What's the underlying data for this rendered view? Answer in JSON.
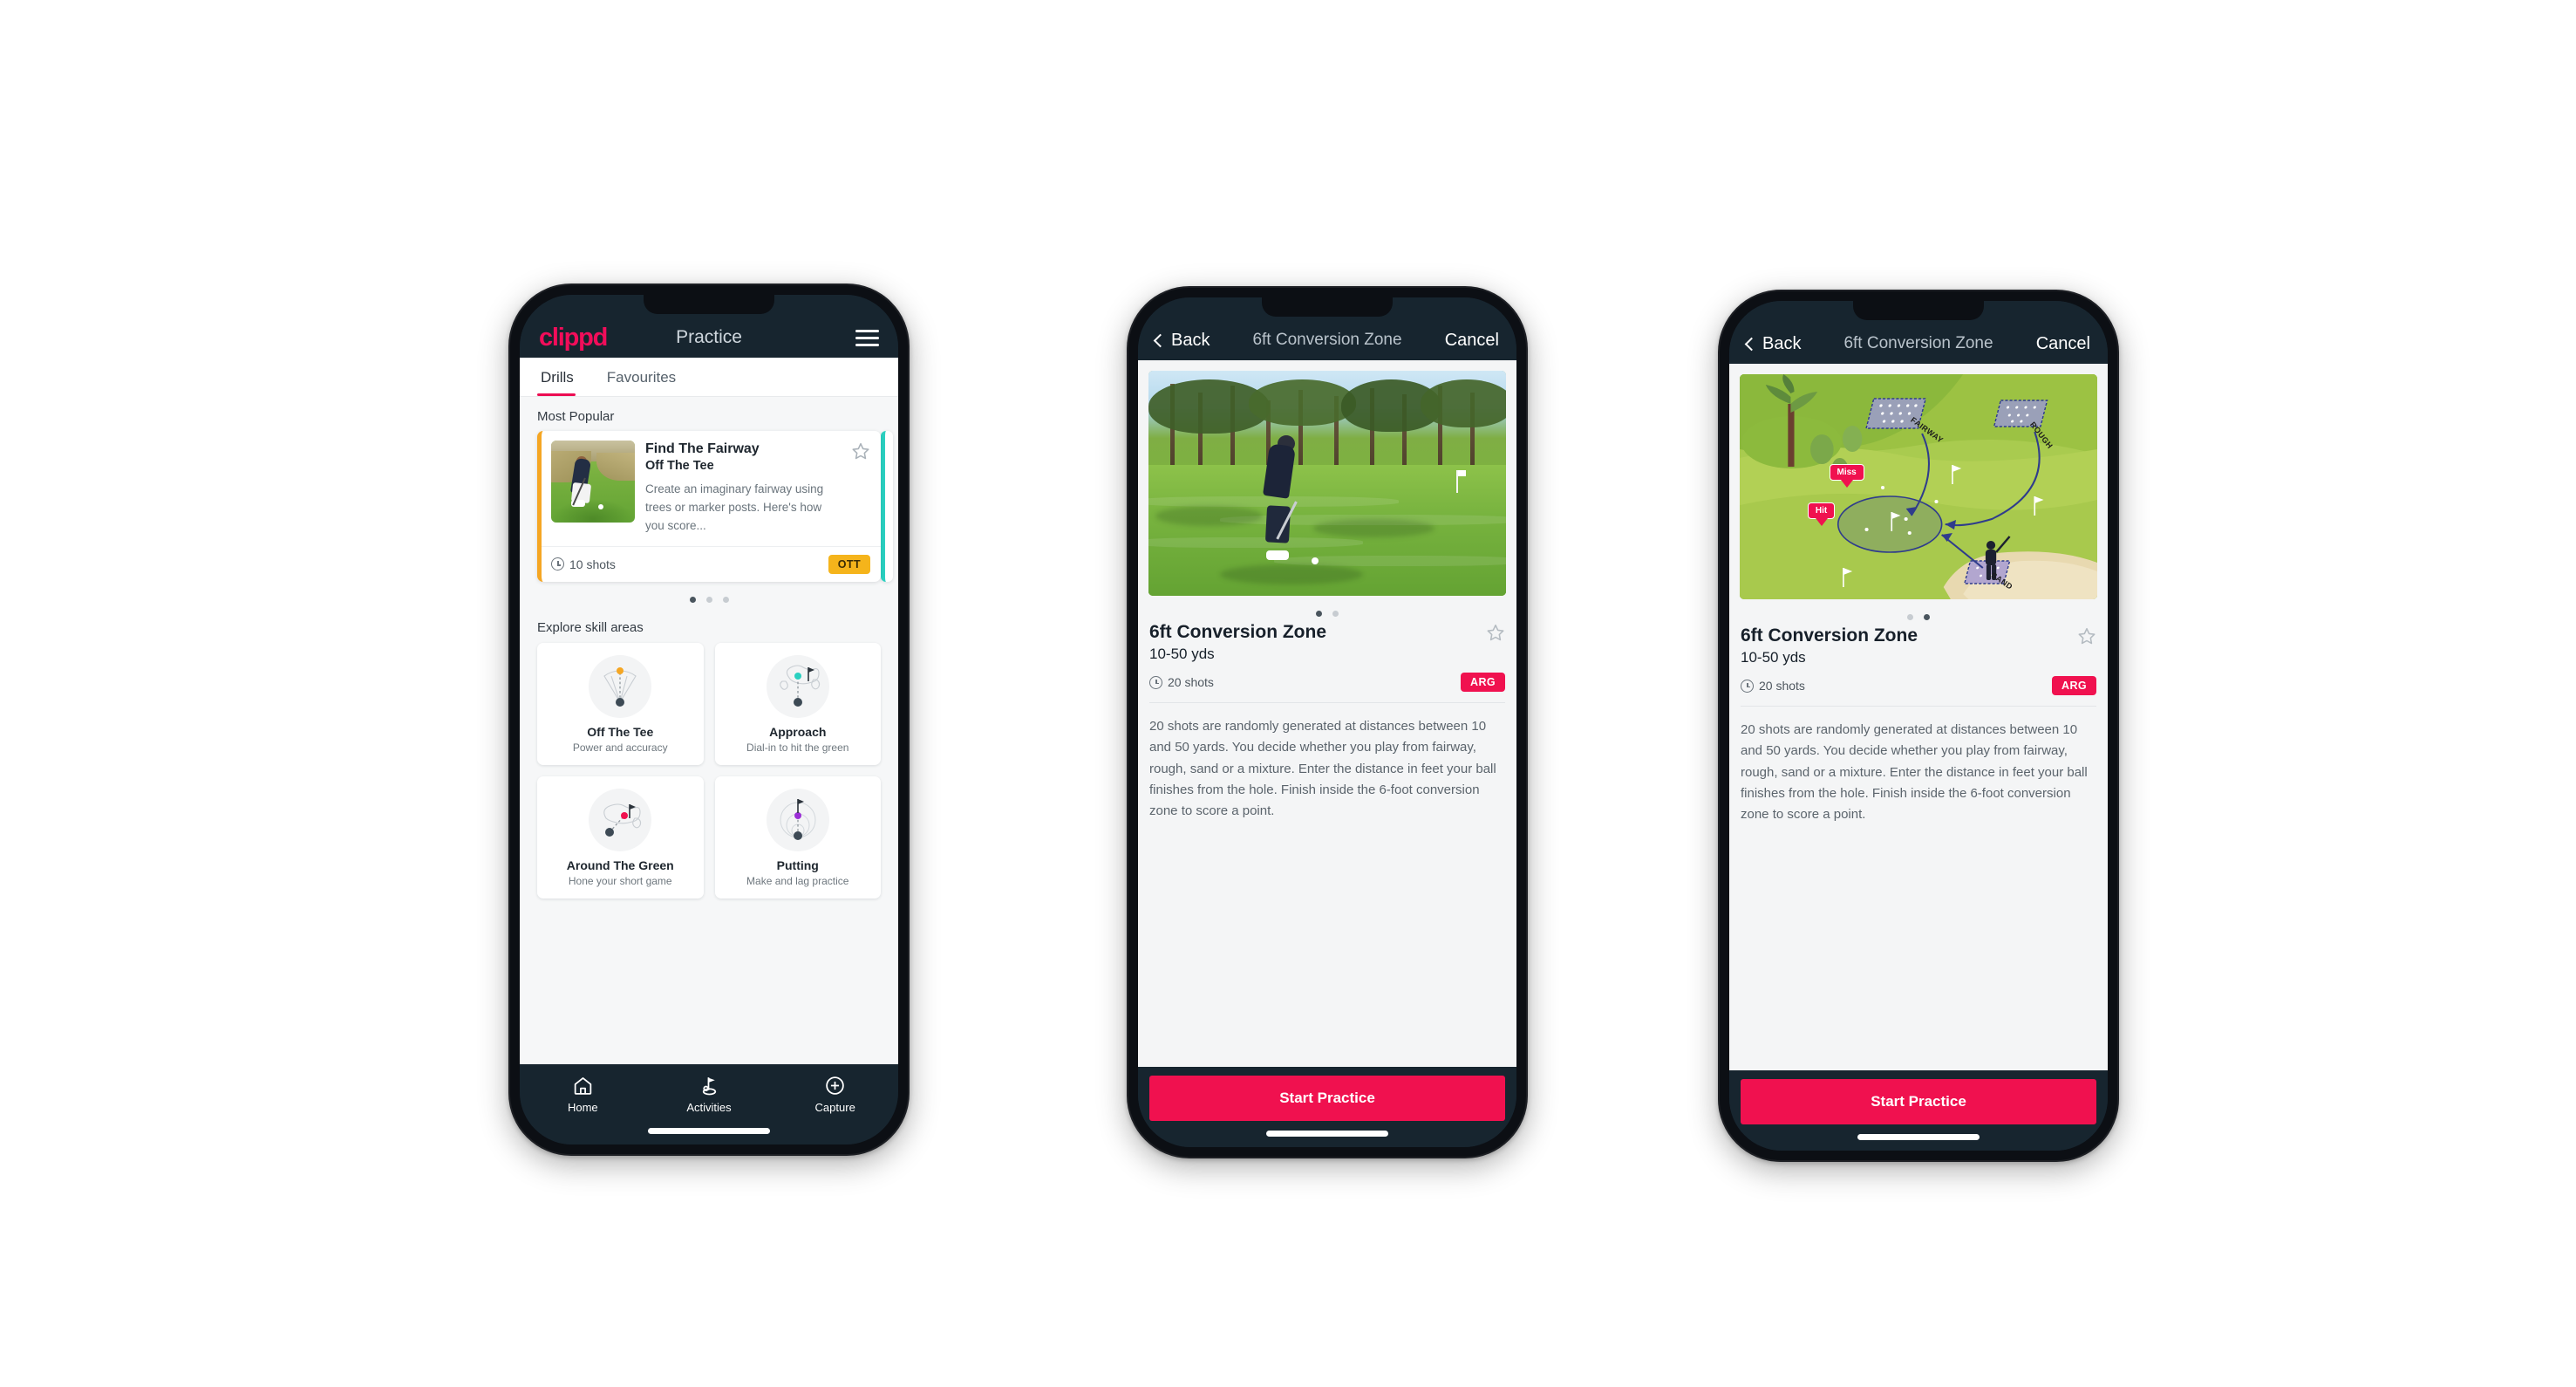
{
  "phone1": {
    "appbar": {
      "logo": "clippd",
      "title": "Practice",
      "menu_icon": "hamburger-icon"
    },
    "tabs": [
      {
        "label": "Drills",
        "active": true
      },
      {
        "label": "Favourites",
        "active": false
      }
    ],
    "most_popular": {
      "heading": "Most Popular",
      "card": {
        "title": "Find The Fairway",
        "subtitle": "Off The Tee",
        "description": "Create an imaginary fairway using trees or marker posts. Here's how you score...",
        "shots": "10 shots",
        "badge": "OTT",
        "badge_color": "#f5b41b",
        "accent_color": "#f5a623",
        "peek_accent_color": "#2ad0c0",
        "star_icon": "star-outline-icon"
      },
      "dots": [
        true,
        false,
        false
      ]
    },
    "skill_areas": {
      "heading": "Explore skill areas",
      "items": [
        {
          "name": "Off The Tee",
          "desc": "Power and accuracy",
          "icon": "tee-fan-icon",
          "dot_color": "#f5a623"
        },
        {
          "name": "Approach",
          "desc": "Dial-in to hit the green",
          "icon": "approach-green-icon",
          "dot_color": "#2ad0c0"
        },
        {
          "name": "Around The Green",
          "desc": "Hone your short game",
          "icon": "around-green-icon",
          "dot_color": "#f0114f"
        },
        {
          "name": "Putting",
          "desc": "Make and lag practice",
          "icon": "putting-rings-icon",
          "dot_color": "#9b2ed6"
        }
      ]
    },
    "bottom_nav": [
      {
        "label": "Home",
        "icon": "home-icon",
        "active": false
      },
      {
        "label": "Activities",
        "icon": "golf-flag-icon",
        "active": true
      },
      {
        "label": "Capture",
        "icon": "plus-circle-icon",
        "active": false
      }
    ]
  },
  "phone2": {
    "modalbar": {
      "back": "Back",
      "title": "6ft Conversion Zone",
      "cancel": "Cancel",
      "back_icon": "chevron-left-icon"
    },
    "media": {
      "type": "photo",
      "alt": "Golfer chipping on a tree-lined course"
    },
    "dots": [
      true,
      false
    ],
    "detail": {
      "title": "6ft Conversion Zone",
      "distance": "10-50 yds",
      "shots": "20 shots",
      "badge": "ARG",
      "badge_color": "#f0114f",
      "star_icon": "star-outline-icon",
      "description": "20 shots are randomly generated at distances between 10 and 50 yards. You decide whether you play from fairway, rough, sand or a mixture. Enter the distance in feet your ball finishes from the hole. Finish inside the 6-foot conversion zone to score a point."
    },
    "cta": "Start Practice"
  },
  "phone3": {
    "modalbar": {
      "back": "Back",
      "title": "6ft Conversion Zone",
      "cancel": "Cancel",
      "back_icon": "chevron-left-icon"
    },
    "media": {
      "type": "course-map",
      "labels": [
        "FAIRWAY",
        "ROUGH",
        "SAND"
      ],
      "callouts": [
        "Miss",
        "Hit"
      ]
    },
    "dots": [
      false,
      true
    ],
    "detail": {
      "title": "6ft Conversion Zone",
      "distance": "10-50 yds",
      "shots": "20 shots",
      "badge": "ARG",
      "badge_color": "#f0114f",
      "star_icon": "star-outline-icon",
      "description": "20 shots are randomly generated at distances between 10 and 50 yards. You decide whether you play from fairway, rough, sand or a mixture. Enter the distance in feet your ball finishes from the hole. Finish inside the 6-foot conversion zone to score a point."
    },
    "cta": "Start Practice"
  }
}
